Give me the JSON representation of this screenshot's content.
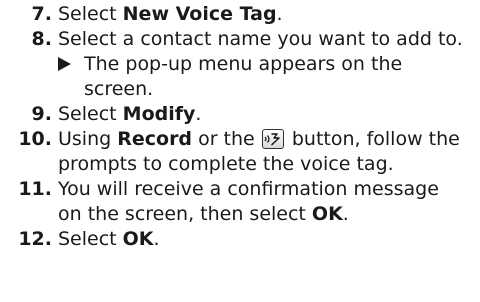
{
  "steps": [
    {
      "num": "7.",
      "pre": "Select ",
      "bold": "New Voice Tag",
      "post": "."
    },
    {
      "num": "8.",
      "text": "Select a contact name you want to add to.",
      "result_line1": "The pop-up menu appears on the",
      "result_line2": "screen."
    },
    {
      "num": "9.",
      "pre": "Select ",
      "bold": "Modify",
      "post": "."
    },
    {
      "num": "10.",
      "pre": "Using ",
      "bold": "Record",
      "mid": " or the ",
      "post": " button, follow the",
      "line2": "prompts to complete the voice tag.",
      "icon": "voice-talk-button-icon"
    },
    {
      "num": "11.",
      "line1": "You will receive a confirmation message",
      "pre2": "on the screen, then select ",
      "bold": "OK",
      "post2": "."
    },
    {
      "num": "12.",
      "pre": "Select ",
      "bold": "OK",
      "post": "."
    }
  ]
}
